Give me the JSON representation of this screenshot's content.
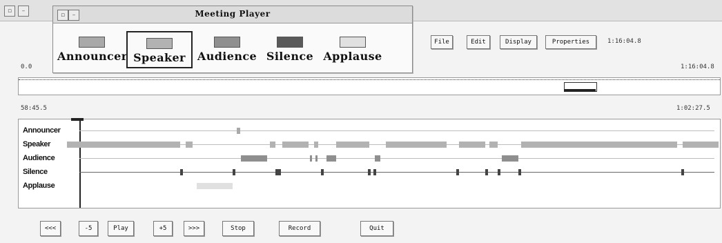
{
  "window": {
    "title": "Meeting Player"
  },
  "legend": {
    "items": [
      {
        "label": "Announcer",
        "color": "#a9a9a9"
      },
      {
        "label": "Speaker",
        "color": "#b2b2b2"
      },
      {
        "label": "Audience",
        "color": "#8f8f8f"
      },
      {
        "label": "Silence",
        "color": "#5a5a5a"
      },
      {
        "label": "Applause",
        "color": "#e0e0e0"
      }
    ],
    "selected": "Speaker"
  },
  "toolbar": {
    "file_label": "File",
    "edit_label": "Edit",
    "display_label": "Display",
    "properties_label": "Properties",
    "total_time": "1:16:04.8"
  },
  "overview": {
    "start_label": "0.0",
    "end_label": "1:16:04.8"
  },
  "detail": {
    "start_label": "58:45.5",
    "end_label": "1:02:27.5"
  },
  "tracks": [
    {
      "name": "Announcer"
    },
    {
      "name": "Speaker"
    },
    {
      "name": "Audience"
    },
    {
      "name": "Silence"
    },
    {
      "name": "Applause"
    }
  ],
  "transport": {
    "rewind_fast_label": "<<<",
    "back5_label": "-5",
    "play_label": "Play",
    "forward5_label": "+5",
    "forward_fast_label": ">>>",
    "stop_label": "Stop",
    "record_label": "Record",
    "quit_label": "Quit"
  }
}
